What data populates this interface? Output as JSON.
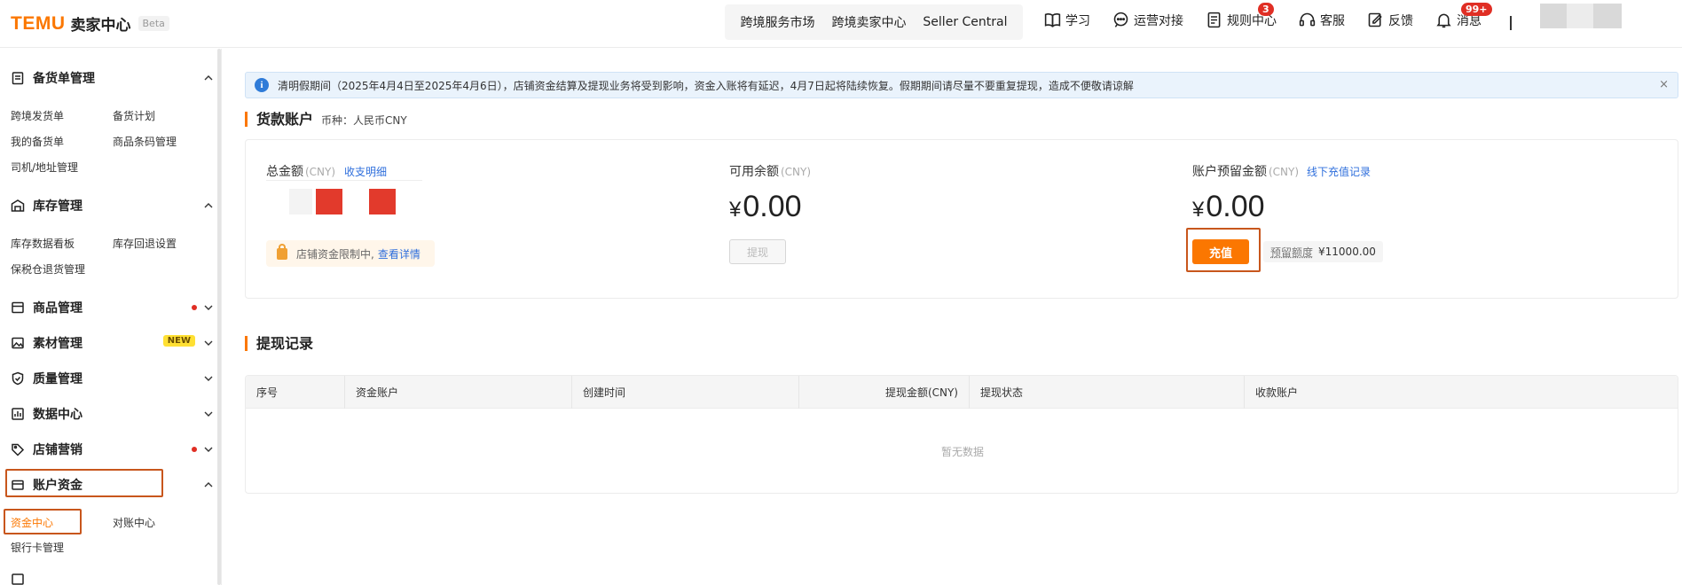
{
  "header": {
    "logo": "TEMU",
    "logo_suffix": "卖家中心",
    "beta": "Beta",
    "nav": [
      "跨境服务市场",
      "跨境卖家中心",
      "Seller Central"
    ],
    "tools": {
      "learn": "学习",
      "ops": "运营对接",
      "rules": "规则中心",
      "rules_badge": "3",
      "service": "客服",
      "feedback": "反馈",
      "messages": "消息",
      "messages_badge": "99+"
    }
  },
  "sidebar": {
    "groups": {
      "stock_order": "备货单管理",
      "inventory": "库存管理",
      "goods": "商品管理",
      "material": "素材管理",
      "material_badge": "NEW",
      "quality": "质量管理",
      "data": "数据中心",
      "marketing": "店铺营销",
      "account": "账户资金"
    },
    "items": {
      "cross_shipping": "跨境发货单",
      "stock_plan": "备货计划",
      "my_stock_order": "我的备货单",
      "barcode": "商品条码管理",
      "driver_address": "司机/地址管理",
      "inventory_board": "库存数据看板",
      "inventory_return": "库存回退设置",
      "bonded_return": "保税仓退货管理",
      "fund_center": "资金中心",
      "reconcile": "对账中心",
      "bank_card": "银行卡管理"
    }
  },
  "notice": {
    "icon": "info-icon",
    "text": "清明假期间（2025年4月4日至2025年4月6日），店铺资金结算及提现业务将受到影响，资金入账将有延迟，4月7日起将陆续恢复。假期期间请尽量不要重复提现，造成不便敬请谅解",
    "close": "×"
  },
  "account": {
    "title": "货款账户",
    "currency": "币种：人民币CNY",
    "total_label": "总金额",
    "unit": "(CNY)",
    "detail_link": "收支明细",
    "restriction_text": "店铺资金限制中,",
    "restriction_link": "查看详情",
    "available_label": "可用余额",
    "available_currency": "¥",
    "available_value": "0.00",
    "withdraw": "提现",
    "reserve_label": "账户预留金额",
    "offline_link": "线下充值记录",
    "reserve_currency": "¥",
    "reserve_value": "0.00",
    "recharge": "充值",
    "reserve_quota_label": "预留额度",
    "reserve_quota_value": "¥11000.00"
  },
  "withdraw_records": {
    "title": "提现记录",
    "columns": [
      "序号",
      "资金账户",
      "创建时间",
      "提现金额(CNY)",
      "提现状态",
      "收款账户"
    ],
    "empty": "暂无数据"
  }
}
